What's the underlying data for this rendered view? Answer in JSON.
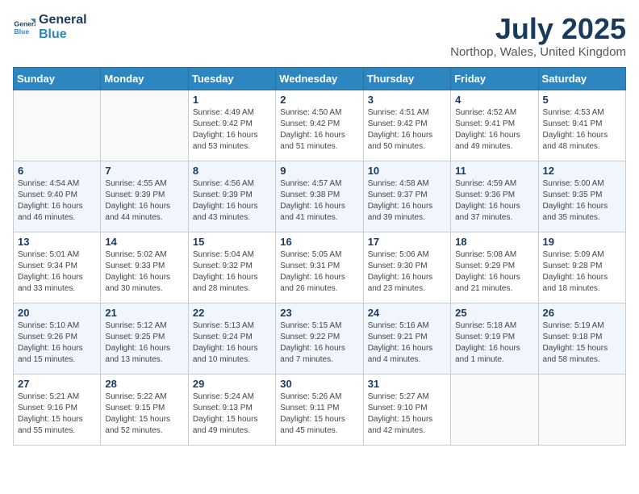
{
  "logo": {
    "line1": "General",
    "line2": "Blue"
  },
  "header": {
    "month": "July 2025",
    "location": "Northop, Wales, United Kingdom"
  },
  "days_of_week": [
    "Sunday",
    "Monday",
    "Tuesday",
    "Wednesday",
    "Thursday",
    "Friday",
    "Saturday"
  ],
  "weeks": [
    [
      {
        "day": "",
        "sunrise": "",
        "sunset": "",
        "daylight": ""
      },
      {
        "day": "",
        "sunrise": "",
        "sunset": "",
        "daylight": ""
      },
      {
        "day": "1",
        "sunrise": "Sunrise: 4:49 AM",
        "sunset": "Sunset: 9:42 PM",
        "daylight": "Daylight: 16 hours and 53 minutes."
      },
      {
        "day": "2",
        "sunrise": "Sunrise: 4:50 AM",
        "sunset": "Sunset: 9:42 PM",
        "daylight": "Daylight: 16 hours and 51 minutes."
      },
      {
        "day": "3",
        "sunrise": "Sunrise: 4:51 AM",
        "sunset": "Sunset: 9:42 PM",
        "daylight": "Daylight: 16 hours and 50 minutes."
      },
      {
        "day": "4",
        "sunrise": "Sunrise: 4:52 AM",
        "sunset": "Sunset: 9:41 PM",
        "daylight": "Daylight: 16 hours and 49 minutes."
      },
      {
        "day": "5",
        "sunrise": "Sunrise: 4:53 AM",
        "sunset": "Sunset: 9:41 PM",
        "daylight": "Daylight: 16 hours and 48 minutes."
      }
    ],
    [
      {
        "day": "6",
        "sunrise": "Sunrise: 4:54 AM",
        "sunset": "Sunset: 9:40 PM",
        "daylight": "Daylight: 16 hours and 46 minutes."
      },
      {
        "day": "7",
        "sunrise": "Sunrise: 4:55 AM",
        "sunset": "Sunset: 9:39 PM",
        "daylight": "Daylight: 16 hours and 44 minutes."
      },
      {
        "day": "8",
        "sunrise": "Sunrise: 4:56 AM",
        "sunset": "Sunset: 9:39 PM",
        "daylight": "Daylight: 16 hours and 43 minutes."
      },
      {
        "day": "9",
        "sunrise": "Sunrise: 4:57 AM",
        "sunset": "Sunset: 9:38 PM",
        "daylight": "Daylight: 16 hours and 41 minutes."
      },
      {
        "day": "10",
        "sunrise": "Sunrise: 4:58 AM",
        "sunset": "Sunset: 9:37 PM",
        "daylight": "Daylight: 16 hours and 39 minutes."
      },
      {
        "day": "11",
        "sunrise": "Sunrise: 4:59 AM",
        "sunset": "Sunset: 9:36 PM",
        "daylight": "Daylight: 16 hours and 37 minutes."
      },
      {
        "day": "12",
        "sunrise": "Sunrise: 5:00 AM",
        "sunset": "Sunset: 9:35 PM",
        "daylight": "Daylight: 16 hours and 35 minutes."
      }
    ],
    [
      {
        "day": "13",
        "sunrise": "Sunrise: 5:01 AM",
        "sunset": "Sunset: 9:34 PM",
        "daylight": "Daylight: 16 hours and 33 minutes."
      },
      {
        "day": "14",
        "sunrise": "Sunrise: 5:02 AM",
        "sunset": "Sunset: 9:33 PM",
        "daylight": "Daylight: 16 hours and 30 minutes."
      },
      {
        "day": "15",
        "sunrise": "Sunrise: 5:04 AM",
        "sunset": "Sunset: 9:32 PM",
        "daylight": "Daylight: 16 hours and 28 minutes."
      },
      {
        "day": "16",
        "sunrise": "Sunrise: 5:05 AM",
        "sunset": "Sunset: 9:31 PM",
        "daylight": "Daylight: 16 hours and 26 minutes."
      },
      {
        "day": "17",
        "sunrise": "Sunrise: 5:06 AM",
        "sunset": "Sunset: 9:30 PM",
        "daylight": "Daylight: 16 hours and 23 minutes."
      },
      {
        "day": "18",
        "sunrise": "Sunrise: 5:08 AM",
        "sunset": "Sunset: 9:29 PM",
        "daylight": "Daylight: 16 hours and 21 minutes."
      },
      {
        "day": "19",
        "sunrise": "Sunrise: 5:09 AM",
        "sunset": "Sunset: 9:28 PM",
        "daylight": "Daylight: 16 hours and 18 minutes."
      }
    ],
    [
      {
        "day": "20",
        "sunrise": "Sunrise: 5:10 AM",
        "sunset": "Sunset: 9:26 PM",
        "daylight": "Daylight: 16 hours and 15 minutes."
      },
      {
        "day": "21",
        "sunrise": "Sunrise: 5:12 AM",
        "sunset": "Sunset: 9:25 PM",
        "daylight": "Daylight: 16 hours and 13 minutes."
      },
      {
        "day": "22",
        "sunrise": "Sunrise: 5:13 AM",
        "sunset": "Sunset: 9:24 PM",
        "daylight": "Daylight: 16 hours and 10 minutes."
      },
      {
        "day": "23",
        "sunrise": "Sunrise: 5:15 AM",
        "sunset": "Sunset: 9:22 PM",
        "daylight": "Daylight: 16 hours and 7 minutes."
      },
      {
        "day": "24",
        "sunrise": "Sunrise: 5:16 AM",
        "sunset": "Sunset: 9:21 PM",
        "daylight": "Daylight: 16 hours and 4 minutes."
      },
      {
        "day": "25",
        "sunrise": "Sunrise: 5:18 AM",
        "sunset": "Sunset: 9:19 PM",
        "daylight": "Daylight: 16 hours and 1 minute."
      },
      {
        "day": "26",
        "sunrise": "Sunrise: 5:19 AM",
        "sunset": "Sunset: 9:18 PM",
        "daylight": "Daylight: 15 hours and 58 minutes."
      }
    ],
    [
      {
        "day": "27",
        "sunrise": "Sunrise: 5:21 AM",
        "sunset": "Sunset: 9:16 PM",
        "daylight": "Daylight: 15 hours and 55 minutes."
      },
      {
        "day": "28",
        "sunrise": "Sunrise: 5:22 AM",
        "sunset": "Sunset: 9:15 PM",
        "daylight": "Daylight: 15 hours and 52 minutes."
      },
      {
        "day": "29",
        "sunrise": "Sunrise: 5:24 AM",
        "sunset": "Sunset: 9:13 PM",
        "daylight": "Daylight: 15 hours and 49 minutes."
      },
      {
        "day": "30",
        "sunrise": "Sunrise: 5:26 AM",
        "sunset": "Sunset: 9:11 PM",
        "daylight": "Daylight: 15 hours and 45 minutes."
      },
      {
        "day": "31",
        "sunrise": "Sunrise: 5:27 AM",
        "sunset": "Sunset: 9:10 PM",
        "daylight": "Daylight: 15 hours and 42 minutes."
      },
      {
        "day": "",
        "sunrise": "",
        "sunset": "",
        "daylight": ""
      },
      {
        "day": "",
        "sunrise": "",
        "sunset": "",
        "daylight": ""
      }
    ]
  ]
}
